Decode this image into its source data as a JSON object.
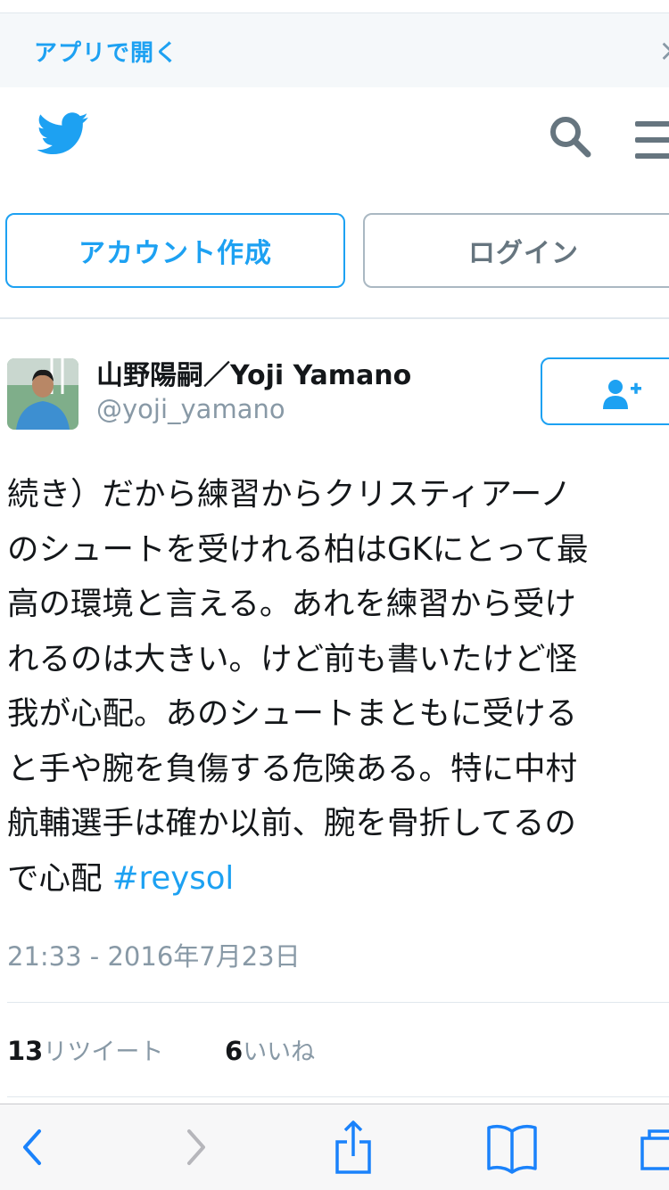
{
  "banner": {
    "open_in_app": "アプリで開く",
    "close_icon": "×"
  },
  "header": {
    "logo_icon": "twitter-bird",
    "search_icon": "search",
    "menu_icon": "hamburger"
  },
  "auth": {
    "signup_label": "アカウント作成",
    "login_label": "ログイン"
  },
  "tweet": {
    "display_name": "山野陽嗣／Yoji Yamano",
    "handle": "@yoji_yamano",
    "text_lines": [
      "続き）だから練習からクリスティアーノ",
      "のシュートを受けれる柏はGKにとって最",
      "高の環境と言える。あれを練習から受け",
      "れるのは大きい。けど前も書いたけど怪",
      "我が心配。あのシュートまともに受ける",
      "と手や腕を負傷する危険ある。特に中村",
      "航輔選手は確か以前、腕を骨折してるの"
    ],
    "last_line_text": "で心配 ",
    "hashtag": "#reysol",
    "timestamp": "21:33 - 2016年7月23日",
    "retweet_count": "13",
    "retweet_label": "リツイート",
    "like_count": "6",
    "like_label": "いいね"
  },
  "colors": {
    "accent": "#1da1f2",
    "muted": "#8899a6",
    "text": "#14171a"
  }
}
